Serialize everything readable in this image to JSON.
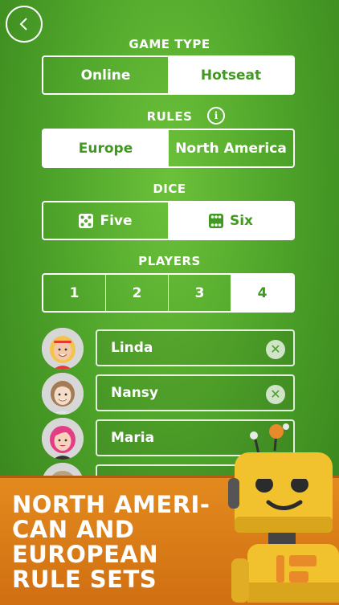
{
  "game_type": {
    "title": "GAME TYPE",
    "options": [
      "Online",
      "Hotseat"
    ],
    "selected": "Hotseat"
  },
  "rules": {
    "title": "RULES",
    "info_icon": "i",
    "options": [
      "Europe",
      "North America"
    ],
    "selected": "Europe"
  },
  "dice": {
    "title": "DICE",
    "options": [
      "Five",
      "Six"
    ],
    "selected": "Five",
    "icons": [
      "die-five-icon",
      "die-six-icon"
    ]
  },
  "players": {
    "title": "PLAYERS",
    "options": [
      "1",
      "2",
      "3",
      "4"
    ],
    "selected": "4",
    "list": [
      {
        "name": "Linda"
      },
      {
        "name": "Nansy"
      },
      {
        "name": "Maria"
      },
      {
        "name": ""
      }
    ]
  },
  "banner": {
    "lines": [
      "NORTH AMERI-",
      "CAN AND",
      "EUROPEAN",
      "RULE SETS"
    ]
  },
  "colors": {
    "table_green": "#4fa52a",
    "selected_text": "#3f9a1f",
    "banner_orange": "#d97c17",
    "robot_yellow": "#f2c12e"
  }
}
